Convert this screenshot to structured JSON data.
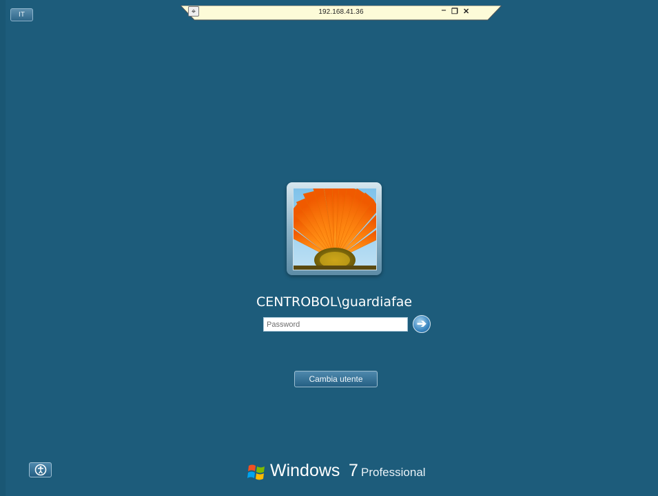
{
  "remote_bar": {
    "host": "192.168.41.36",
    "pin_icon": "pin-icon",
    "minimize_label": "_",
    "restore_label": "ё",
    "close_label": "×"
  },
  "language": {
    "label": "IT"
  },
  "login": {
    "username": "CENTROBOL\\guardiafae",
    "password_placeholder": "Password",
    "password_value": "",
    "submit_icon": "arrow-right-icon",
    "switch_user_label": "Cambia utente"
  },
  "footer": {
    "ease_of_access_icon": "ease-of-access-icon",
    "brand_name": "Windows",
    "brand_version": "7",
    "brand_edition": "Professional"
  },
  "colors": {
    "background": "#1d5c7b",
    "button": "#2f6b90",
    "text": "#ffffff"
  }
}
